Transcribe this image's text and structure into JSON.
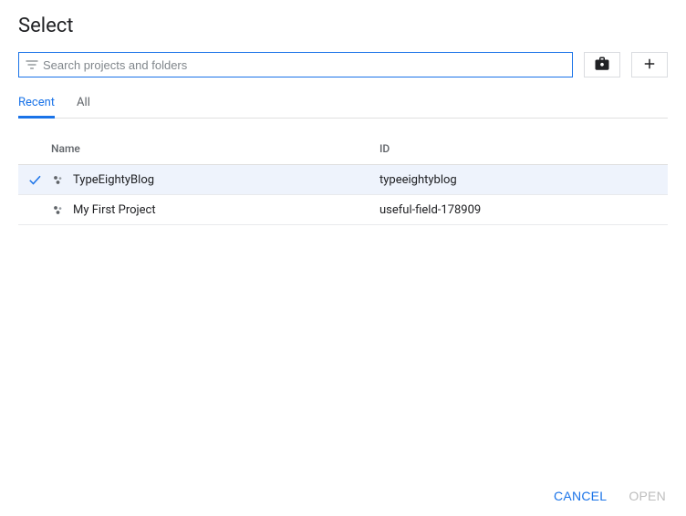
{
  "title": "Select",
  "search": {
    "placeholder": "Search projects and folders"
  },
  "tabs": {
    "recent": "Recent",
    "all": "All"
  },
  "headers": {
    "name": "Name",
    "id": "ID"
  },
  "rows": [
    {
      "name": "TypeEightyBlog",
      "id": "typeeightyblog",
      "selected": true
    },
    {
      "name": "My First Project",
      "id": "useful-field-178909",
      "selected": false
    }
  ],
  "actions": {
    "cancel": "CANCEL",
    "open": "OPEN"
  }
}
